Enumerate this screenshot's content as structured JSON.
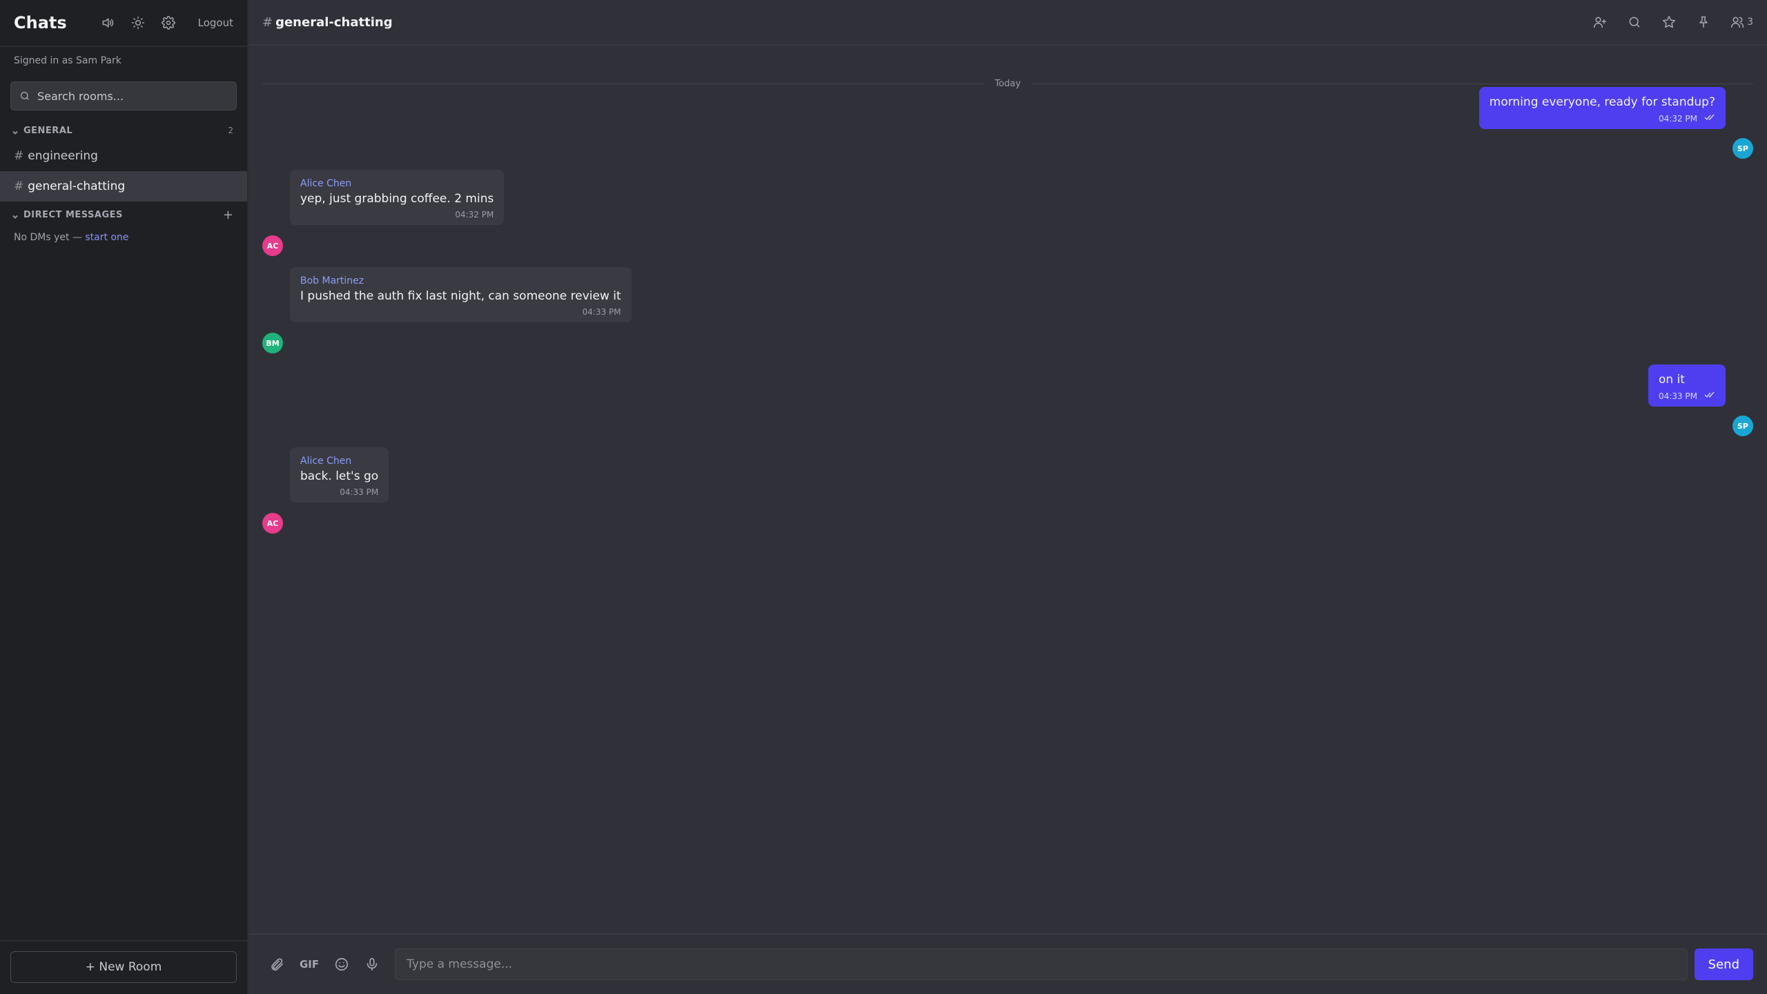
{
  "sidebar": {
    "title": "Chats",
    "logout_label": "Logout",
    "signed_in": "Signed in as Sam Park",
    "search_placeholder": "Search rooms...",
    "general_label": "GENERAL",
    "general_count": "2",
    "rooms": [
      {
        "name": "engineering",
        "active": false
      },
      {
        "name": "general-chatting",
        "active": true
      }
    ],
    "dm_label": "DIRECT MESSAGES",
    "dm_empty_prefix": "No DMs yet —",
    "dm_empty_link": "start one",
    "new_room_label": "+ New Room"
  },
  "channel": {
    "name": "general-chatting",
    "member_count": "3"
  },
  "date_divider": "Today",
  "messages": [
    {
      "direction": "out",
      "text": "morning everyone, ready for standup?",
      "time": "04:32 PM",
      "avatar": "SP"
    },
    {
      "direction": "in",
      "sender": "Alice Chen",
      "text": "yep, just grabbing coffee. 2 mins",
      "time": "04:32 PM",
      "avatar": "AC"
    },
    {
      "direction": "in",
      "sender": "Bob Martinez",
      "text": "I pushed the auth fix last night, can someone review it",
      "time": "04:33 PM",
      "avatar": "BM"
    },
    {
      "direction": "out",
      "text": "on it",
      "time": "04:33 PM",
      "avatar": "SP"
    },
    {
      "direction": "in",
      "sender": "Alice Chen",
      "text": "back. let's go",
      "time": "04:33 PM",
      "avatar": "AC"
    }
  ],
  "composer": {
    "gif_label": "GIF",
    "placeholder": "Type a message...",
    "send_label": "Send"
  },
  "colors": {
    "accent": "#4f3ef0",
    "avatar_ac": "#e73b8c",
    "avatar_bm": "#1fb27a",
    "avatar_sp": "#1aa6d4"
  }
}
